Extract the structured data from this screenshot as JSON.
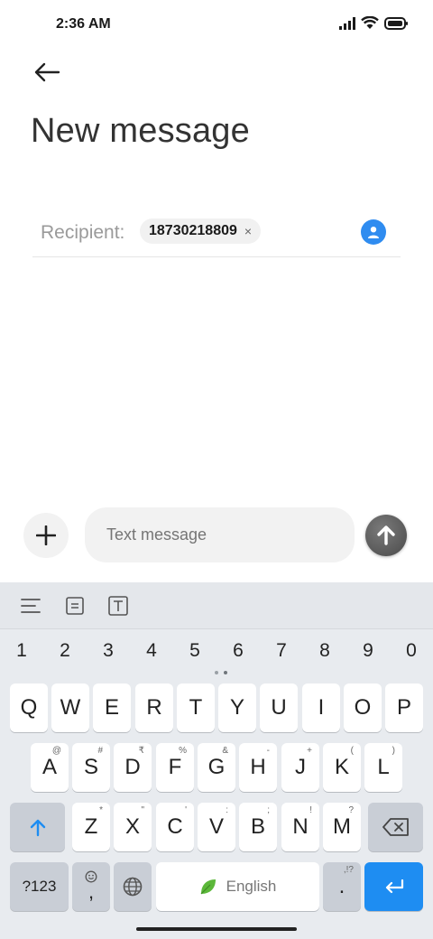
{
  "status": {
    "time": "2:36 AM"
  },
  "header": {
    "title": "New message"
  },
  "recipient": {
    "label": "Recipient:",
    "chip": "18730218809",
    "chip_close": "×"
  },
  "compose": {
    "placeholder": "Text message"
  },
  "keyboard": {
    "numbers": [
      "1",
      "2",
      "3",
      "4",
      "5",
      "6",
      "7",
      "8",
      "9",
      "0"
    ],
    "row1": [
      "Q",
      "W",
      "E",
      "R",
      "T",
      "Y",
      "U",
      "I",
      "O",
      "P"
    ],
    "row2": [
      {
        "k": "A",
        "h": "@"
      },
      {
        "k": "S",
        "h": "#"
      },
      {
        "k": "D",
        "h": "₹"
      },
      {
        "k": "F",
        "h": "%"
      },
      {
        "k": "G",
        "h": "&"
      },
      {
        "k": "H",
        "h": "-"
      },
      {
        "k": "J",
        "h": "+"
      },
      {
        "k": "K",
        "h": "("
      },
      {
        "k": "L",
        "h": ")"
      }
    ],
    "row3": [
      {
        "k": "Z",
        "h": "*"
      },
      {
        "k": "X",
        "h": "\""
      },
      {
        "k": "C",
        "h": "'"
      },
      {
        "k": "V",
        "h": ":"
      },
      {
        "k": "B",
        "h": ";"
      },
      {
        "k": "N",
        "h": "!"
      },
      {
        "k": "M",
        "h": "?"
      }
    ],
    "symbols_label": "?123",
    "comma_label": ",",
    "space_label": "English",
    "period_label": ".",
    "period_hint": ",!?"
  },
  "colors": {
    "accent": "#1e8df2",
    "contact": "#2f8cf0",
    "send": "#555555"
  }
}
